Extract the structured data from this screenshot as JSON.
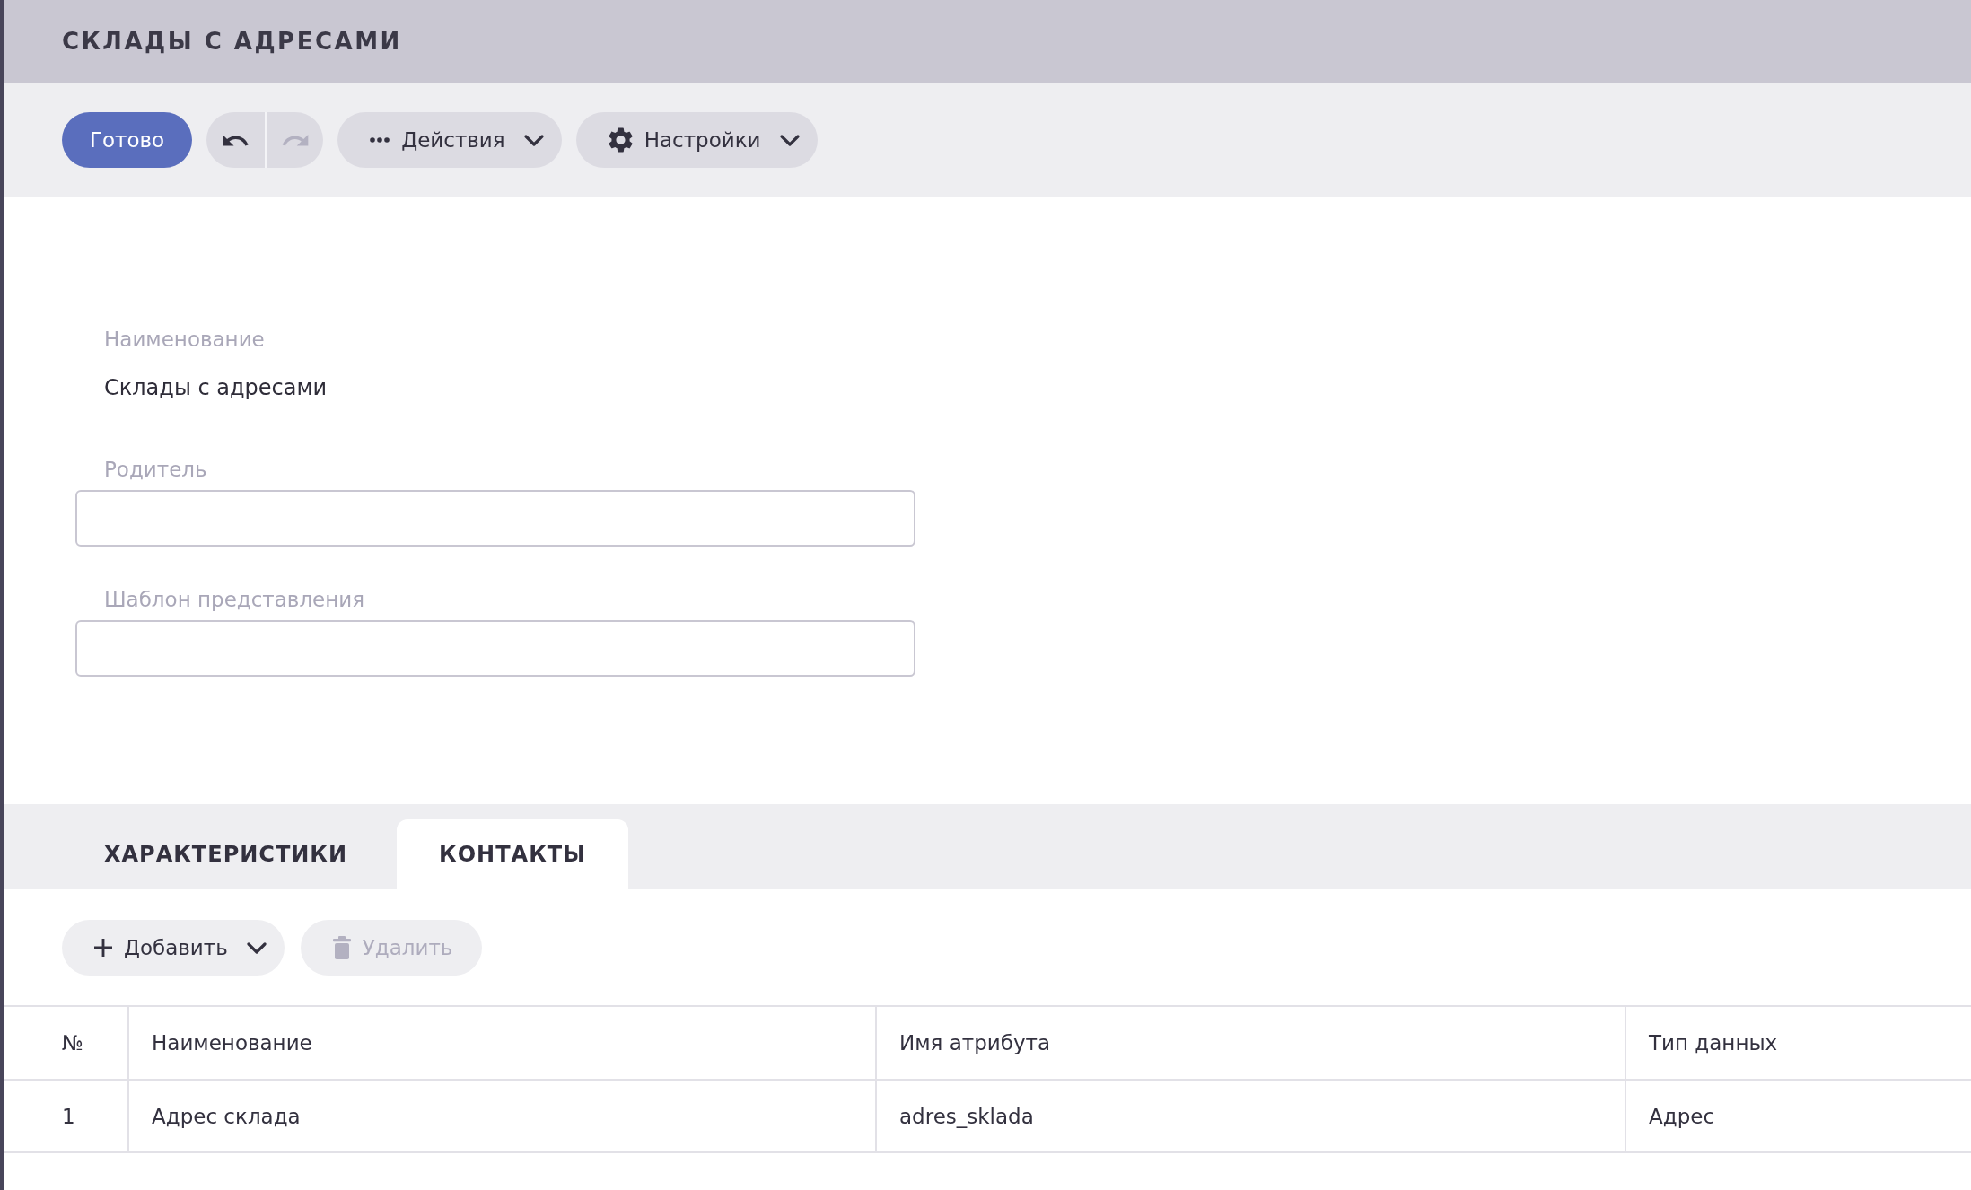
{
  "window": {
    "title": "СКЛАДЫ С АДРЕСАМИ"
  },
  "toolbar": {
    "buttons": [
      {
        "kind": "primary",
        "label": "Готово",
        "disabled": false
      },
      {
        "kind": "undo",
        "disabled": false
      },
      {
        "kind": "redo",
        "disabled": true
      },
      {
        "kind": "actions",
        "label": "Действия",
        "disabled": false
      },
      {
        "kind": "settings",
        "label": "Настройки",
        "disabled": false
      }
    ]
  },
  "form": {
    "fields": [
      {
        "kind": "text",
        "label": "Наименование",
        "value": "Склады с адресами"
      },
      {
        "kind": "input",
        "label": "Родитель"
      },
      {
        "kind": "input",
        "label": "Шаблон представления"
      }
    ]
  },
  "tabs": [
    {
      "label": "ХАРАКТЕРИСТИКИ",
      "selected": false
    },
    {
      "label": "КОНТАКТЫ",
      "selected": true
    }
  ],
  "table_toolbar": {
    "buttons": [
      {
        "kind": "add",
        "label": "Добавить",
        "disabled": false
      },
      {
        "kind": "delete",
        "label": "Удалить",
        "disabled": true
      }
    ]
  },
  "table": {
    "columns": [
      "№",
      "Наименование",
      "Имя атрибута",
      "Тип данных"
    ],
    "rows": [
      [
        "1",
        "Адрес склада",
        "adres_sklada",
        "Адрес"
      ]
    ]
  }
}
